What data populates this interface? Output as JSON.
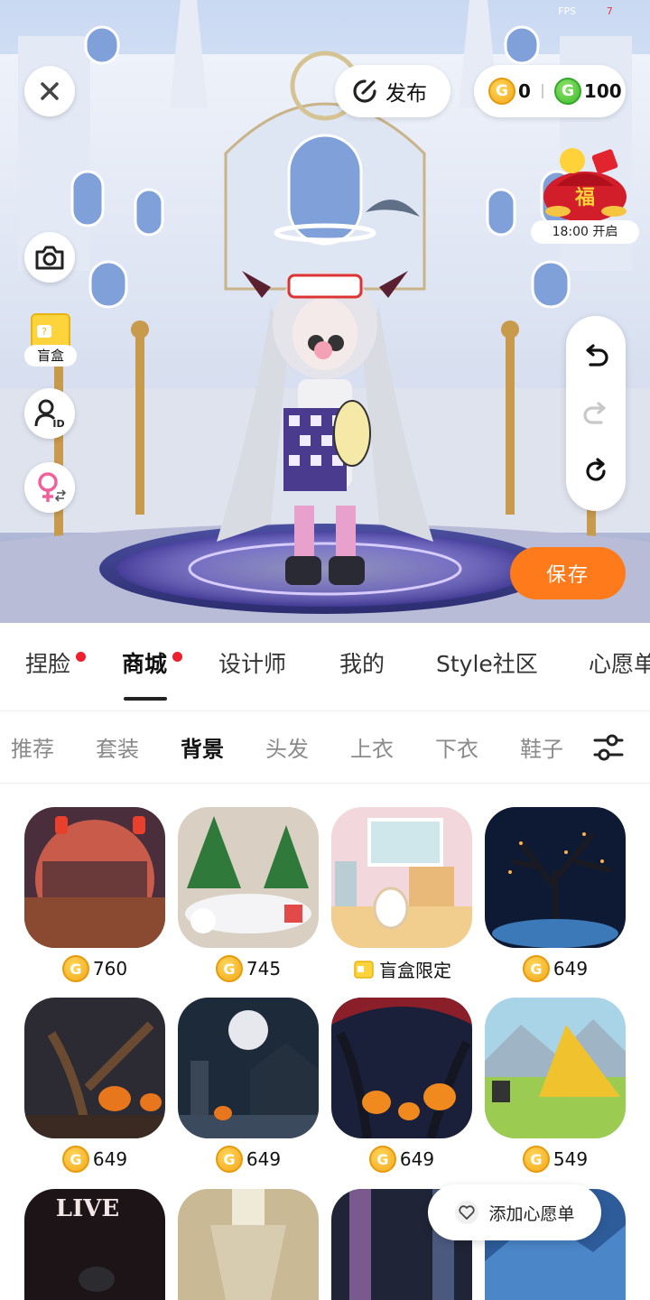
{
  "status": {
    "fps_label": "FPS",
    "fps_value": "7"
  },
  "header": {
    "close_icon": "close-icon",
    "publish_label": "发布",
    "gold_coins": "0",
    "green_coins": "100",
    "coin_glyph": "G"
  },
  "event": {
    "time_label": "18:00 开启",
    "fu_text": "福"
  },
  "left_tools": {
    "blindbox_label": "盲盒",
    "id_badge": "ID"
  },
  "right_tools": {
    "save_label": "保存"
  },
  "main_tabs": [
    {
      "label": "捏脸",
      "dot": true
    },
    {
      "label": "商城",
      "dot": true,
      "active": true
    },
    {
      "label": "设计师"
    },
    {
      "label": "我的"
    },
    {
      "label": "Style社区"
    },
    {
      "label": "心愿单"
    }
  ],
  "sub_tabs": [
    {
      "label": "推荐"
    },
    {
      "label": "套装"
    },
    {
      "label": "背景",
      "active": true
    },
    {
      "label": "头发"
    },
    {
      "label": "上衣"
    },
    {
      "label": "下衣"
    },
    {
      "label": "鞋子"
    }
  ],
  "items": [
    {
      "price": "760"
    },
    {
      "price": "745"
    },
    {
      "price": "盲盒限定",
      "blindbox": true
    },
    {
      "price": "649"
    },
    {
      "price": "649"
    },
    {
      "price": "649"
    },
    {
      "price": "649"
    },
    {
      "price": "549"
    },
    {
      "thumb_text": "LIVE"
    },
    {},
    {},
    {}
  ],
  "wishlist_button": "添加心愿单",
  "colors": {
    "accent": "#ff7a1a",
    "dot": "#ee1f2e",
    "gold": "#f4a81a",
    "green": "#3dbb2d"
  }
}
